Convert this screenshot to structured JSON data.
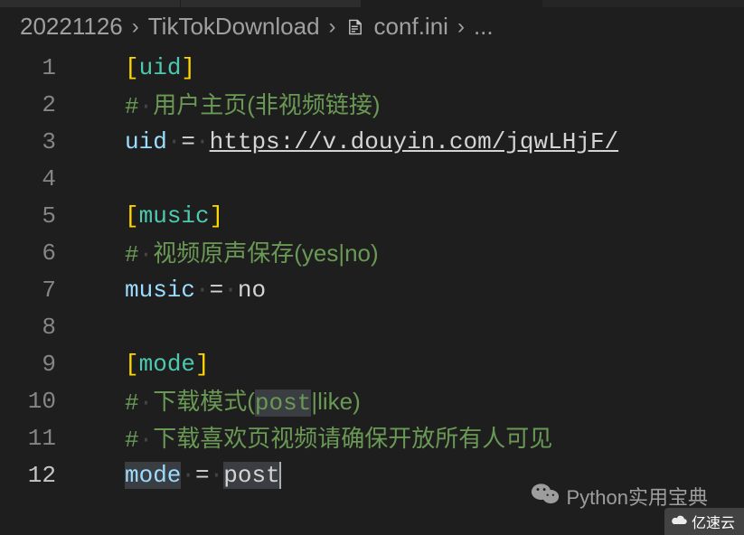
{
  "breadcrumb": {
    "root": "20221126",
    "folder": "TikTokDownload",
    "file": "conf.ini",
    "tail": "..."
  },
  "gutter": [
    "1",
    "2",
    "3",
    "4",
    "5",
    "6",
    "7",
    "8",
    "9",
    "10",
    "11",
    "12"
  ],
  "code": {
    "l1": {
      "b1": "[",
      "section": "uid",
      "b2": "]"
    },
    "l2": {
      "hash": "#",
      "dot": "·",
      "text": "用户主页(非视频链接)"
    },
    "l3": {
      "key": "uid",
      "dot": "·",
      "eq": "=",
      "url": "https://v.douyin.com/jqwLHjF/"
    },
    "l5": {
      "b1": "[",
      "section": "music",
      "b2": "]"
    },
    "l6": {
      "hash": "#",
      "dot": "·",
      "text": "视频原声保存(yes|no)"
    },
    "l7": {
      "key": "music",
      "dot": "·",
      "eq": "=",
      "val": "no"
    },
    "l9": {
      "b1": "[",
      "section": "mode",
      "b2": "]"
    },
    "l10": {
      "hash": "#",
      "dot": "·",
      "text1": "下载模式(",
      "hl": "post",
      "text2": "|like)"
    },
    "l11": {
      "hash": "#",
      "dot": "·",
      "text": "下载喜欢页视频请确保开放所有人可见"
    },
    "l12": {
      "key": "mode",
      "dot": "·",
      "eq": "=",
      "val": "post"
    }
  },
  "watermarks": {
    "wx": "Python实用宝典",
    "site": "亿速云"
  },
  "colors": {
    "bg": "#1e1e1e",
    "bracket": "#ffd700",
    "section": "#4ec9b0",
    "comment": "#6a9955",
    "key": "#9cdcfe"
  }
}
